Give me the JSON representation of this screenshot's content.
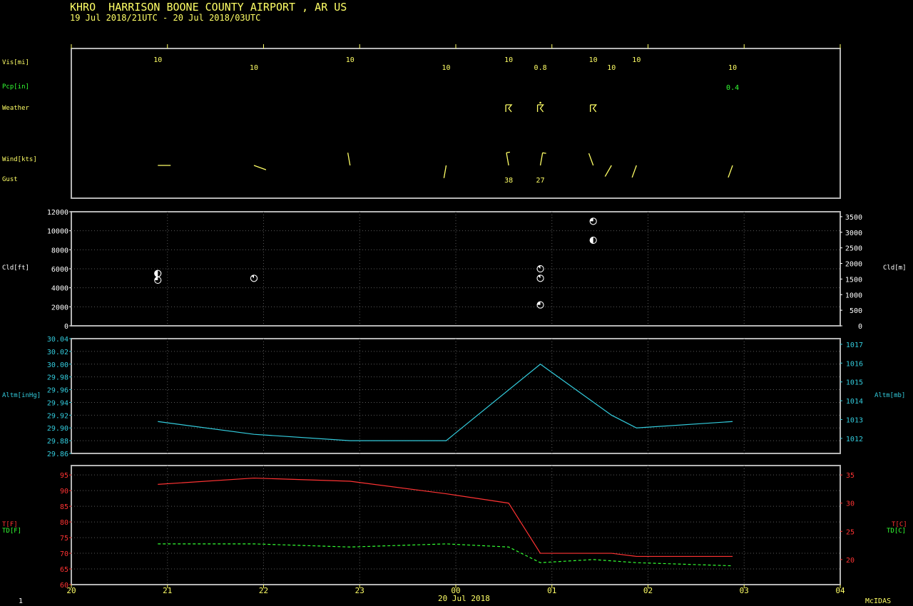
{
  "header": {
    "title": "KHRO  HARRISON BOONE COUNTY AIRPORT , AR US",
    "subtitle": "19 Jul 2018/21UTC - 20 Jul 2018/03UTC"
  },
  "labels": {
    "vis": "Vis[mi]",
    "pcp": "Pcp[in]",
    "weather": "Weather",
    "wind": "Wind[kts]",
    "gust": "Gust",
    "cld_ft": "Cld[ft]",
    "cld_m": "Cld[m]",
    "altm_inhg": "Altm[inHg]",
    "altm_mb": "Altm[mb]",
    "t_f": "T[F]",
    "td_f": "TD[F]",
    "t_c": "T[C]",
    "td_c": "TD[C]"
  },
  "footer": {
    "page": "1",
    "date": "20 Jul 2018",
    "brand": "McIDAS"
  },
  "colors": {
    "frame": "#b4b4b4",
    "yellow": "#ffff66",
    "green": "#33ff33",
    "cyan": "#33ccdd",
    "red": "#ff3333",
    "white": "#ffffff"
  },
  "chart_data": [
    {
      "type": "table",
      "panel": "surface-obs",
      "x_unit": "hour UTC",
      "vis": [
        {
          "hour": 20.9,
          "value": "10"
        },
        {
          "hour": 21.9,
          "value": "10"
        },
        {
          "hour": 22.9,
          "value": "10"
        },
        {
          "hour": 23.9,
          "value": "10"
        },
        {
          "hour": 24.55,
          "value": "10"
        },
        {
          "hour": 24.88,
          "value": "0.8"
        },
        {
          "hour": 25.43,
          "value": "10"
        },
        {
          "hour": 25.62,
          "value": "10"
        },
        {
          "hour": 25.88,
          "value": "10"
        },
        {
          "hour": 26.88,
          "value": "10"
        }
      ],
      "pcp": [
        {
          "hour": 26.88,
          "value": "0.4"
        }
      ],
      "weather": [
        {
          "hour": 24.55,
          "symbol": "thunderstorm"
        },
        {
          "hour": 24.88,
          "symbol": "thunderstorm-rain"
        },
        {
          "hour": 25.43,
          "symbol": "thunderstorm"
        }
      ],
      "wind": [
        {
          "hour": 20.9,
          "dir": 90,
          "speed": 5
        },
        {
          "hour": 21.9,
          "dir": 110,
          "speed": 5
        },
        {
          "hour": 22.9,
          "dir": 350,
          "speed": 5
        },
        {
          "hour": 23.9,
          "dir": 190,
          "speed": 5
        },
        {
          "hour": 24.55,
          "dir": 350,
          "speed": 15
        },
        {
          "hour": 24.88,
          "dir": 10,
          "speed": 10
        },
        {
          "hour": 25.43,
          "dir": 340,
          "speed": 5
        },
        {
          "hour": 25.62,
          "dir": 210,
          "speed": 5
        },
        {
          "hour": 25.88,
          "dir": 200,
          "speed": 5
        },
        {
          "hour": 26.88,
          "dir": 200,
          "speed": 5
        }
      ],
      "gust": [
        {
          "hour": 24.55,
          "value": "38"
        },
        {
          "hour": 24.88,
          "value": "27"
        }
      ]
    },
    {
      "type": "scatter",
      "panel": "cloud-height",
      "ylabel": "Cld[ft]",
      "ylabel_right": "Cld[m]",
      "ylim": [
        0,
        12000
      ],
      "yticks": [
        0,
        2000,
        4000,
        6000,
        8000,
        10000,
        12000
      ],
      "ylim_right": [
        0,
        3658
      ],
      "yticks_right": [
        0,
        500,
        1000,
        1500,
        2000,
        2500,
        3000,
        3500
      ],
      "points": [
        {
          "hour": 20.9,
          "ft": 5500,
          "cover": "SCT"
        },
        {
          "hour": 20.9,
          "ft": 4800,
          "cover": "BKN"
        },
        {
          "hour": 21.9,
          "ft": 5000,
          "cover": "OVC"
        },
        {
          "hour": 24.88,
          "ft": 6000,
          "cover": "OVC"
        },
        {
          "hour": 24.88,
          "ft": 5000,
          "cover": "OVC"
        },
        {
          "hour": 24.88,
          "ft": 2200,
          "cover": "BKN"
        },
        {
          "hour": 25.43,
          "ft": 11000,
          "cover": "BKN"
        },
        {
          "hour": 25.43,
          "ft": 9000,
          "cover": "SCT"
        }
      ],
      "grid": true
    },
    {
      "type": "line",
      "panel": "altimeter",
      "ylabel": "Altm[inHg]",
      "ylabel_right": "Altm[mb]",
      "ylim": [
        29.86,
        30.04
      ],
      "yticks": [
        29.86,
        29.88,
        29.9,
        29.92,
        29.94,
        29.96,
        29.98,
        30.0,
        30.02,
        30.04
      ],
      "ylim_right": [
        1011.2,
        1017.3
      ],
      "yticks_right": [
        1012,
        1013,
        1014,
        1015,
        1016,
        1017
      ],
      "series": [
        {
          "color": "#33ccdd",
          "x": [
            20.9,
            21.9,
            22.9,
            23.9,
            24.88,
            25.62,
            25.88,
            26.88
          ],
          "values": [
            29.91,
            29.89,
            29.88,
            29.88,
            30.0,
            29.92,
            29.9,
            29.91
          ]
        }
      ],
      "grid": true
    },
    {
      "type": "line",
      "panel": "temperature",
      "ylabel": "T[F]",
      "ylabel_2": "TD[F]",
      "ylabel_right": "T[C]",
      "ylabel_right_2": "TD[C]",
      "ylim": [
        60,
        98
      ],
      "yticks": [
        60,
        65,
        70,
        75,
        80,
        85,
        90,
        95
      ],
      "yticks_right": [
        20,
        25,
        30,
        35
      ],
      "series": [
        {
          "color": "#ff3333",
          "dash": false,
          "x": [
            20.9,
            21.9,
            22.9,
            23.9,
            24.55,
            24.88,
            25.62,
            25.88,
            26.88
          ],
          "values": [
            92,
            94,
            93,
            89,
            86,
            70,
            70,
            69,
            69
          ]
        },
        {
          "color": "#33ff33",
          "dash": true,
          "x": [
            20.9,
            21.9,
            22.9,
            23.9,
            24.55,
            24.88,
            25.43,
            25.88,
            26.88
          ],
          "values": [
            73,
            73,
            72,
            73,
            72,
            67,
            68,
            67,
            66
          ]
        }
      ],
      "x_ticks": [
        20,
        21,
        22,
        23,
        24,
        25,
        26,
        27,
        28
      ],
      "x_tick_labels": [
        "20",
        "21",
        "22",
        "23",
        "00",
        "01",
        "02",
        "03",
        "04"
      ],
      "grid": true
    }
  ]
}
